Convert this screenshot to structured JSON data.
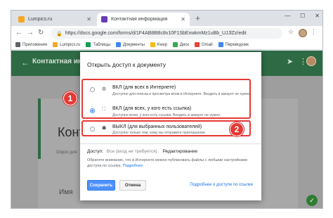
{
  "browser": {
    "tabs": [
      {
        "title": "Lumpics.ru",
        "favicon_color": "#f5a623"
      },
      {
        "title": "Контактная информация - Goo",
        "favicon_color": "#673ab7"
      }
    ],
    "new_tab_symbol": "+",
    "window_controls": [
      "—",
      "☐",
      "✕"
    ],
    "url": "https://docs.google.com/forms/d/1F4AB8BBc8v10F1SbExwkmMz1uBb_UJJlZz/edit",
    "bookmarks": [
      {
        "label": "Приложения",
        "color": "#5f6368"
      },
      {
        "label": "Lumpics.ru",
        "color": "#f5a623"
      },
      {
        "label": "Таблицы",
        "color": "#0f9d58"
      },
      {
        "label": "Документы",
        "color": "#4285f4"
      },
      {
        "label": "Keep",
        "color": "#fbbc04"
      },
      {
        "label": "Диск",
        "color": "#34a853"
      },
      {
        "label": "Gmail",
        "color": "#ea4335"
      },
      {
        "label": "Переводчик",
        "color": "#4285f4"
      }
    ]
  },
  "forms": {
    "header_title": "Контактная ин",
    "card_title": "Конт",
    "card_desc": "Опрос для",
    "name_label": "Имя"
  },
  "dialog": {
    "title": "Открыть доступ к документу",
    "options": [
      {
        "label": "ВКЛ (для всех в Интернете)",
        "sub": "Доступно для поиска и просмотра всем в Интернете. Входить в аккаунт не нужно.",
        "selected": false,
        "icon": "globe-icon"
      },
      {
        "label": "ВКЛ (для всех, у кого есть ссылка)",
        "sub": "Доступно всем, у кого есть ссылка. Входить в аккаунт не нужно.",
        "selected": true,
        "icon": "link-person-icon"
      },
      {
        "label": "ВЫКЛ (для выбранных пользователей)",
        "sub": "Доступно только тем, кому вы отправите приглашение",
        "selected": false,
        "icon": "people-icon"
      }
    ],
    "access_label": "Доступ:",
    "access_value": "Все (вход не требуется)",
    "access_role": "Редактирование",
    "note_text": "Обратите внимание, что в Интернете можно публиковать файлы с любыми настройками доступа по ссылке.",
    "note_link": "Подробнее",
    "save_button": "Сохранить",
    "cancel_button": "Отмена",
    "more_link": "Подробнее о доступе по ссылке"
  },
  "callouts": [
    "1",
    "2"
  ],
  "colors": {
    "accent_red": "#e53935",
    "forms_green": "#2e6a43",
    "link_blue": "#1a73e8",
    "save_blue": "#4d90fe"
  }
}
